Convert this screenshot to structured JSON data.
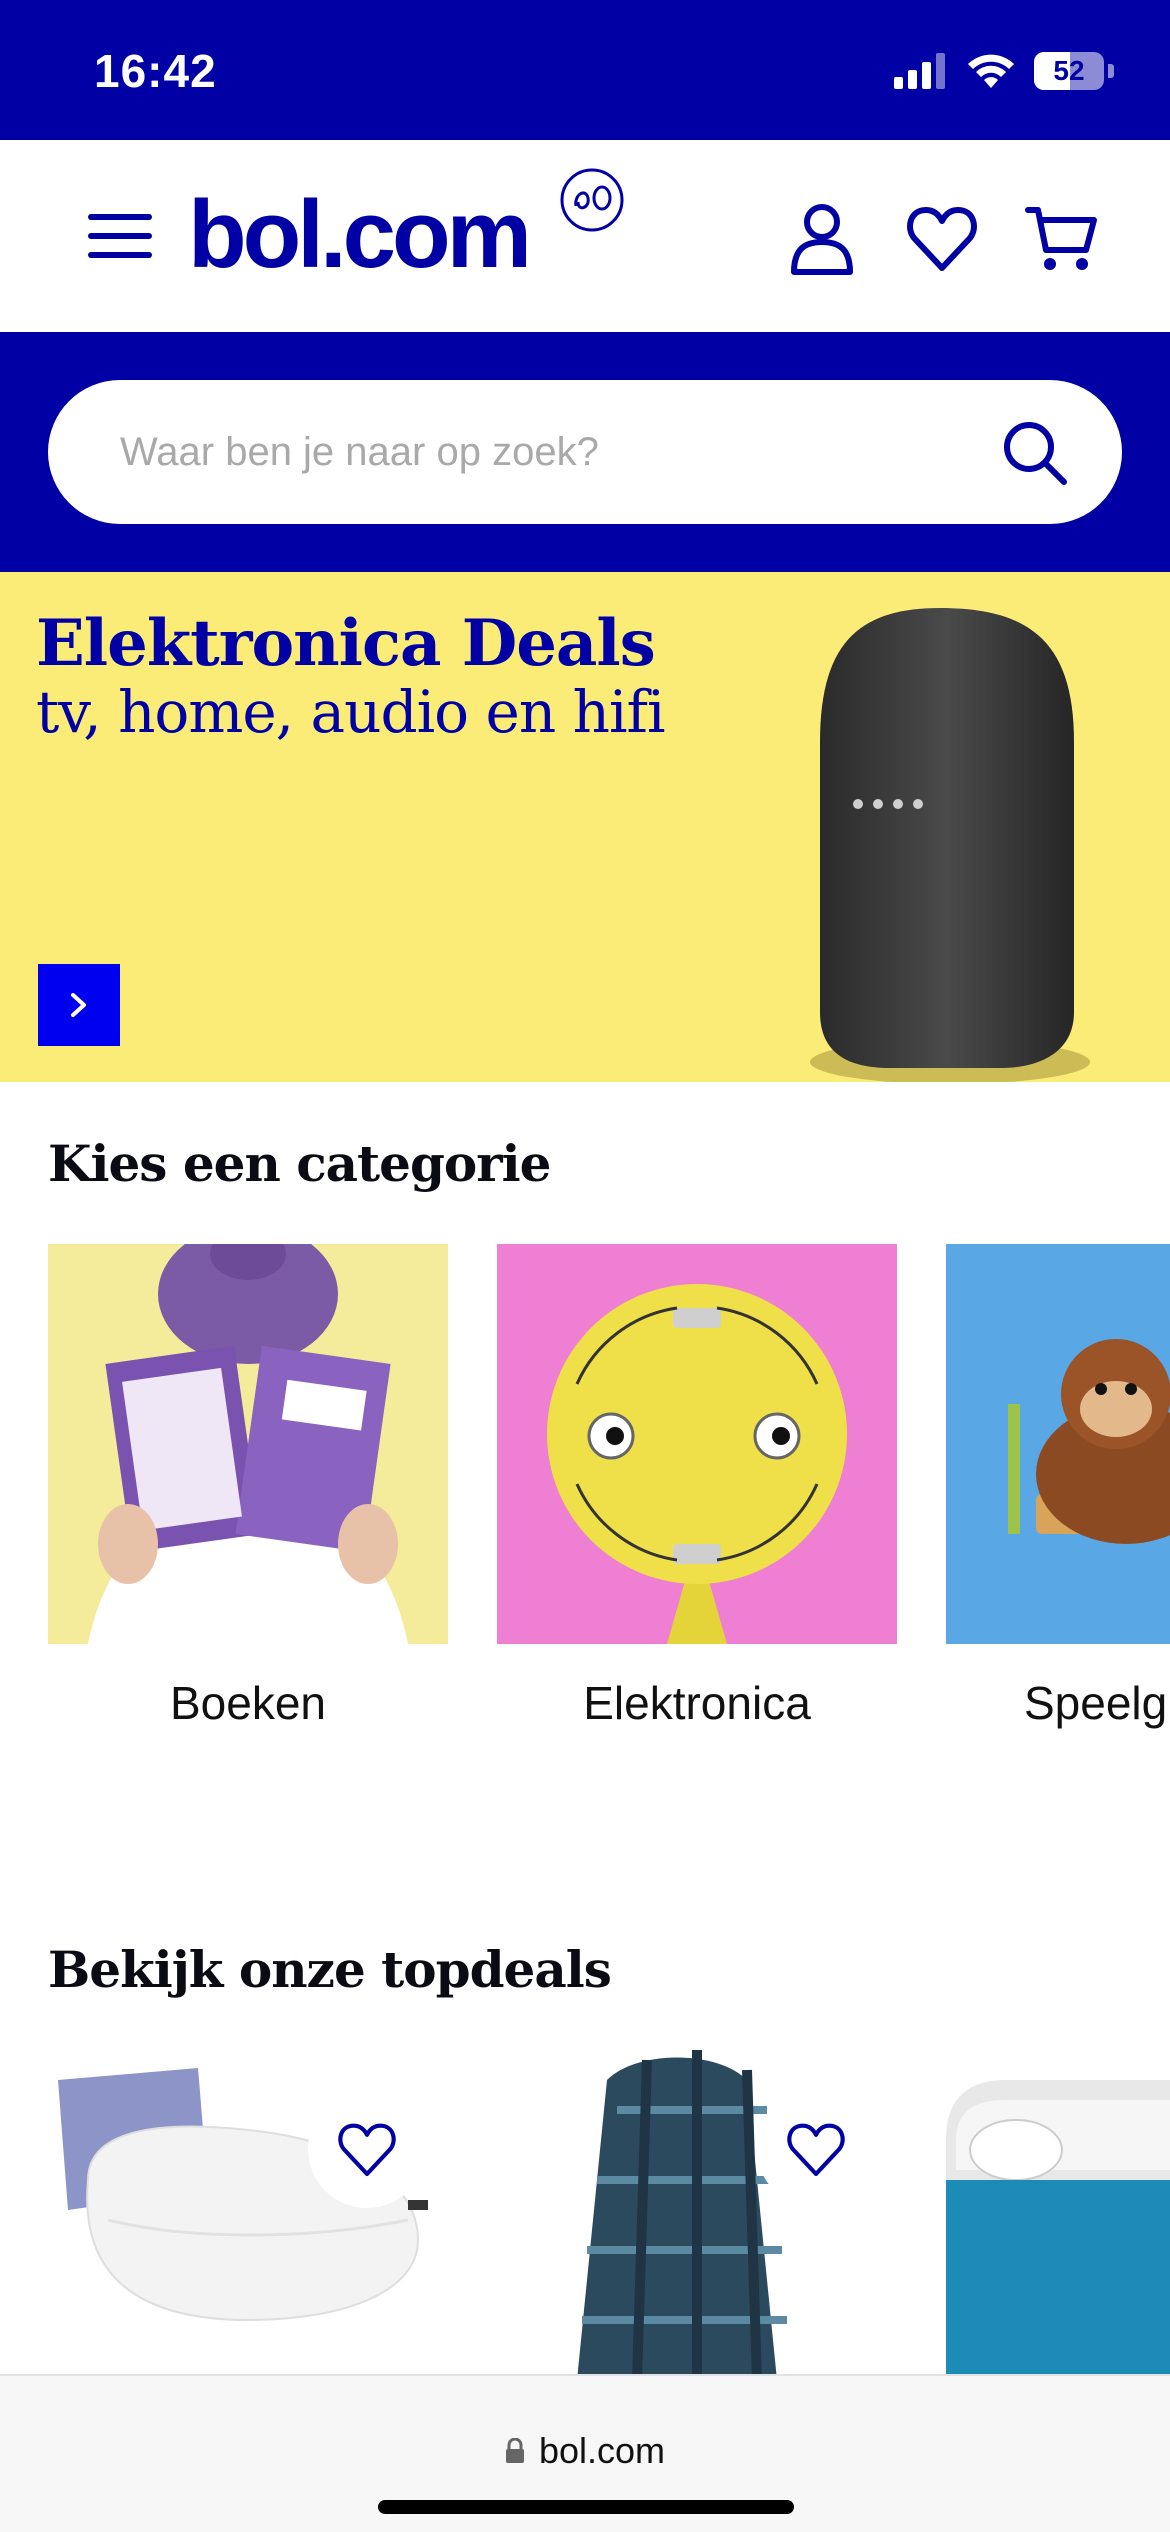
{
  "status_bar": {
    "time": "16:42",
    "battery": "52",
    "battery_level": 0.52
  },
  "header": {
    "logo": "bol.com",
    "icons": [
      "menu-icon",
      "account-icon",
      "heart-icon",
      "cart-icon"
    ]
  },
  "search": {
    "placeholder": "Waar ben je naar op zoek?"
  },
  "banner": {
    "title": "Elektronica Deals",
    "subtitle": "tv, home, audio en hifi"
  },
  "categories": {
    "title": "Kies een categorie",
    "items": [
      {
        "label": "Boeken"
      },
      {
        "label": "Elektronica"
      },
      {
        "label": "Speelg"
      }
    ]
  },
  "topdeals": {
    "title": "Bekijk onze topdeals"
  },
  "browser": {
    "url": "bol.com"
  },
  "colors": {
    "brand_blue": "#0000a4",
    "banner_yellow": "#fbec78",
    "cta_blue": "#0000f0"
  }
}
